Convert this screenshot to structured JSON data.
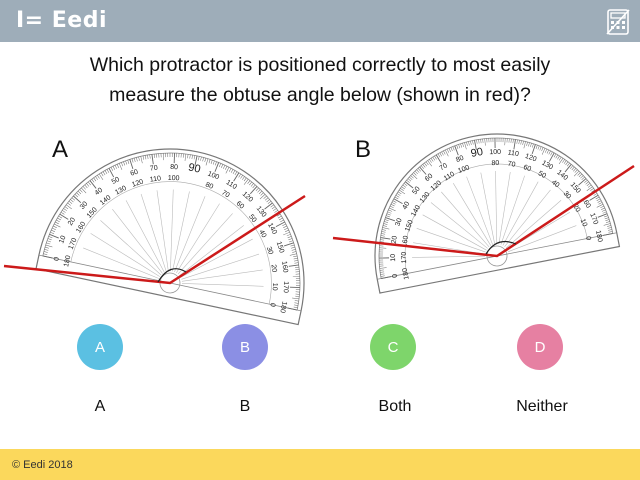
{
  "header": {
    "logo_text": "I= Eedi",
    "calculator_icon": "calculator-icon"
  },
  "question": {
    "line1": "Which protractor is positioned correctly to most easily",
    "line2": "measure  the obtuse angle below (shown in red)?"
  },
  "protractors": {
    "a_label": "A",
    "b_label": "B",
    "labels_outer": [
      "0",
      "10",
      "20",
      "30",
      "40",
      "50",
      "60",
      "70",
      "80",
      "90",
      "100",
      "110",
      "120",
      "130",
      "140",
      "150",
      "160",
      "170",
      "180"
    ],
    "labels_inner": [
      "180",
      "170",
      "160",
      "150",
      "140",
      "130",
      "120",
      "110",
      "100",
      "90",
      "80",
      "70",
      "60",
      "50",
      "40",
      "30",
      "20",
      "10",
      "0"
    ]
  },
  "answers": [
    {
      "letter": "A",
      "text": "A",
      "color": "#5bc0e2"
    },
    {
      "letter": "B",
      "text": "B",
      "color": "#8b8fe4"
    },
    {
      "letter": "C",
      "text": "Both",
      "color": "#7ed56b"
    },
    {
      "letter": "D",
      "text": "Neither",
      "color": "#e680a2"
    }
  ],
  "footer": {
    "copyright": "© Eedi 2018"
  },
  "colors": {
    "header_bg": "#9eadb9",
    "footer_bg": "#fbd85c",
    "angle_line": "#cc1a1a"
  }
}
